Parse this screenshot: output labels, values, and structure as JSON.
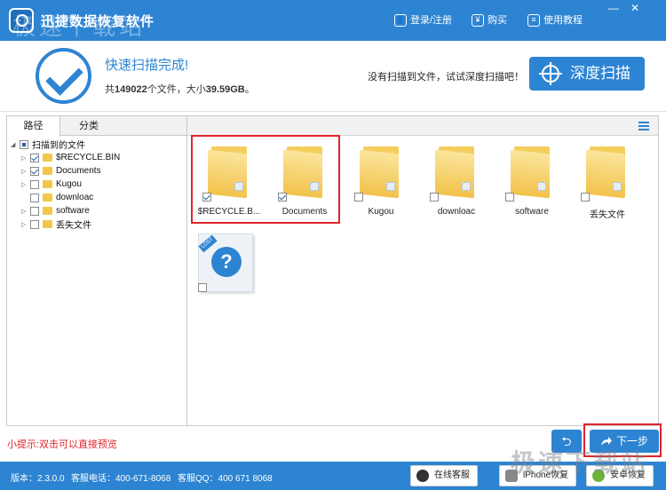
{
  "window": {
    "title": "迅捷数据恢复软件",
    "watermark": "极速下载站",
    "links": [
      {
        "label": "登录/注册",
        "icon": "user-icon"
      },
      {
        "label": "购买",
        "icon": "yen-icon"
      },
      {
        "label": "使用教程",
        "icon": "book-icon"
      }
    ],
    "controls": {
      "minimize": "—",
      "close": "✕"
    }
  },
  "header": {
    "status_title": "快速扫描完成!",
    "stats_prefix": "共",
    "file_count": "149022",
    "stats_mid": "个文件，大小",
    "total_size": "39.59GB",
    "stats_suffix": "。",
    "deep_hint": "没有扫描到文件，试试深度扫描吧！",
    "deep_scan_label": "深度扫描"
  },
  "left_panel": {
    "tabs": [
      "路径",
      "分类"
    ],
    "tree": {
      "root": "扫描到的文件",
      "items": [
        {
          "label": "$RECYCLE.BIN",
          "checked": true
        },
        {
          "label": "Documents",
          "checked": true
        },
        {
          "label": "Kugou",
          "checked": false
        },
        {
          "label": "downloac",
          "checked": false
        },
        {
          "label": "software",
          "checked": false
        },
        {
          "label": "丢失文件",
          "checked": false
        }
      ]
    }
  },
  "files": [
    {
      "label": "$RECYCLE.B...",
      "checked": true,
      "type": "folder"
    },
    {
      "label": "Documents",
      "checked": true,
      "type": "folder"
    },
    {
      "label": "Kugou",
      "checked": false,
      "type": "folder"
    },
    {
      "label": "downloac",
      "checked": false,
      "type": "folder"
    },
    {
      "label": "software",
      "checked": false,
      "type": "folder"
    },
    {
      "label": "丢失文件",
      "checked": false,
      "type": "folder"
    },
    {
      "label": "",
      "checked": false,
      "type": "lost",
      "badge": "LOST"
    }
  ],
  "hint": "小提示:双击可以直接预览",
  "actions": {
    "back": "⮌",
    "next": "下一步"
  },
  "footer": {
    "version": "版本：2.3.0.0",
    "phone": "客服电话：400-671-8068",
    "qq": "客服QQ：400 671 8068",
    "buttons": [
      "在线客服",
      "iPhone恢复",
      "安卓恢复"
    ],
    "watermark": "极速下载站"
  },
  "colors": {
    "accent": "#2d84d2",
    "highlight": "#e0242a",
    "folder": "#f2c24a"
  }
}
